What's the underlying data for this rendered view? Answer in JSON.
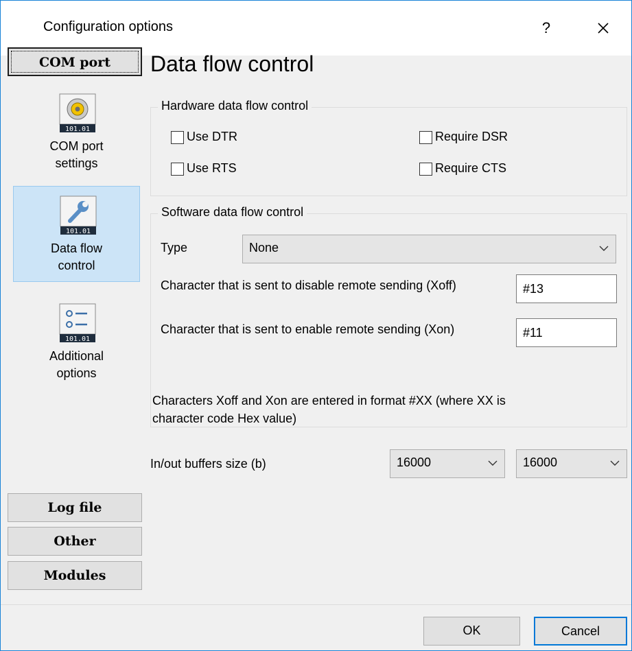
{
  "window": {
    "title": "Configuration options",
    "help_glyph": "?",
    "close_icon": "close-icon"
  },
  "categories": {
    "com_port": "COM port",
    "log_file": "Log file",
    "other": "Other",
    "modules": "Modules"
  },
  "nav": [
    {
      "label_line1": "COM port",
      "label_line2": "settings",
      "icon": "serial-port-icon",
      "active": false
    },
    {
      "label_line1": "Data flow",
      "label_line2": "control",
      "icon": "wrench-icon",
      "active": true
    },
    {
      "label_line1": "Additional",
      "label_line2": "options",
      "icon": "options-list-icon",
      "active": false
    }
  ],
  "icon_badge": "101.01",
  "section_title": "Data flow control",
  "hardware": {
    "legend": "Hardware data flow control",
    "use_dtr": {
      "label": "Use DTR",
      "checked": false
    },
    "use_rts": {
      "label": "Use RTS",
      "checked": false
    },
    "require_dsr": {
      "label": "Require DSR",
      "checked": false
    },
    "require_cts": {
      "label": "Require CTS",
      "checked": false
    }
  },
  "software": {
    "legend": "Software data flow control",
    "type_label": "Type",
    "type_value": "None",
    "xoff_label": "Character that is sent to disable remote sending (Xoff)",
    "xoff_value": "#13",
    "xon_label": "Character that is sent to enable remote sending (Xon)",
    "xon_value": "#11",
    "note_line1": "Characters Xoff and Xon are entered in format #XX (where XX is",
    "note_line2": "character code Hex value)"
  },
  "buffers": {
    "label": "In/out buffers size (b)",
    "in_value": "16000",
    "out_value": "16000"
  },
  "buttons": {
    "ok": "OK",
    "cancel": "Cancel"
  },
  "colors": {
    "accent": "#0078d7",
    "selected_bg": "#cce4f7",
    "window_border": "#1883d7"
  }
}
